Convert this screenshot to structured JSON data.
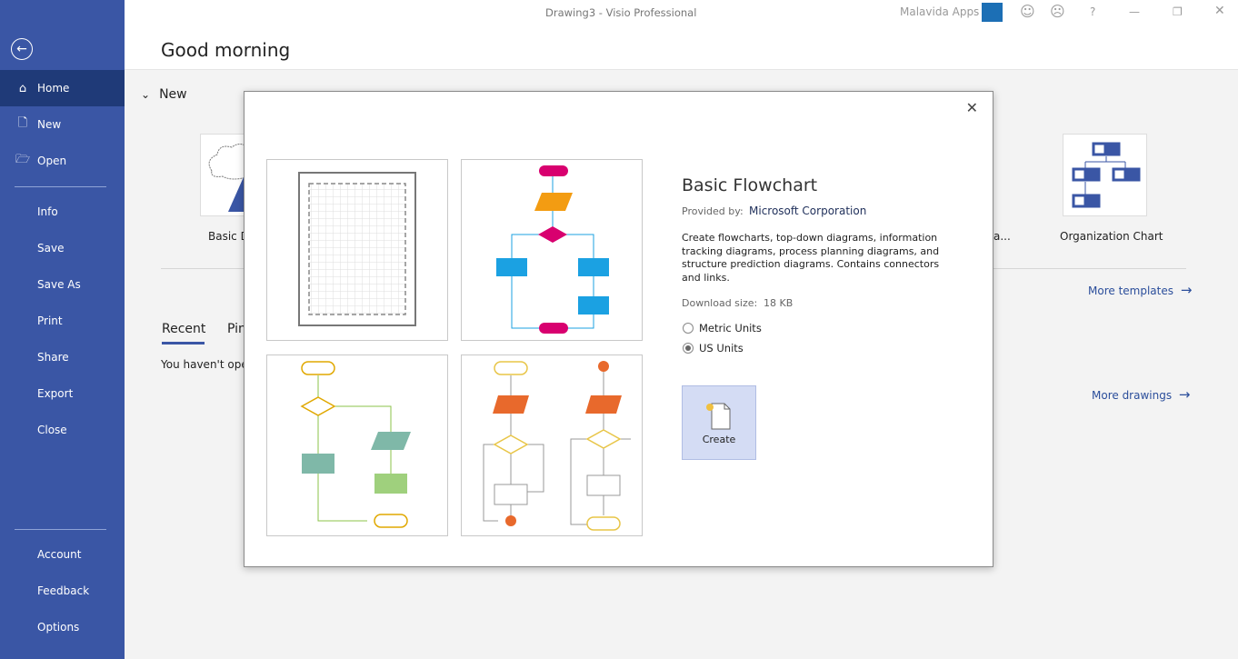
{
  "window": {
    "title": "Drawing3  -  Visio Professional",
    "user": "Malavida Apps",
    "help": "?"
  },
  "sidebar": {
    "items": [
      {
        "label": "Home",
        "icon": "home-icon"
      },
      {
        "label": "New",
        "icon": "new-file-icon"
      },
      {
        "label": "Open",
        "icon": "folder-open-icon"
      },
      {
        "label": "Info"
      },
      {
        "label": "Save"
      },
      {
        "label": "Save As"
      },
      {
        "label": "Print"
      },
      {
        "label": "Share"
      },
      {
        "label": "Export"
      },
      {
        "label": "Close"
      },
      {
        "label": "Account"
      },
      {
        "label": "Feedback"
      },
      {
        "label": "Options"
      }
    ]
  },
  "main": {
    "greeting": "Good morning",
    "new_heading": "New",
    "templates": [
      {
        "label": "Basic D"
      },
      {
        "label": "a..."
      },
      {
        "label": "Organization Chart"
      }
    ],
    "more_templates": "More templates",
    "tabs": [
      {
        "label": "Recent"
      },
      {
        "label": "Pin"
      }
    ],
    "empty_text": "You haven't open",
    "more_drawings": "More drawings"
  },
  "dialog": {
    "title": "Basic Flowchart",
    "provided_label": "Provided by:",
    "provider": "Microsoft Corporation",
    "description": "Create flowcharts, top-down diagrams, information tracking diagrams, process planning diagrams, and structure prediction diagrams. Contains connectors and links.",
    "size_label": "Download size:",
    "size": "18 KB",
    "units": [
      {
        "label": "Metric Units",
        "selected": false
      },
      {
        "label": "US Units",
        "selected": true
      }
    ],
    "create": "Create"
  },
  "colors": {
    "sidebar": "#3a56a5",
    "active": "#1f3a78",
    "accent": "#2b4e9b"
  }
}
